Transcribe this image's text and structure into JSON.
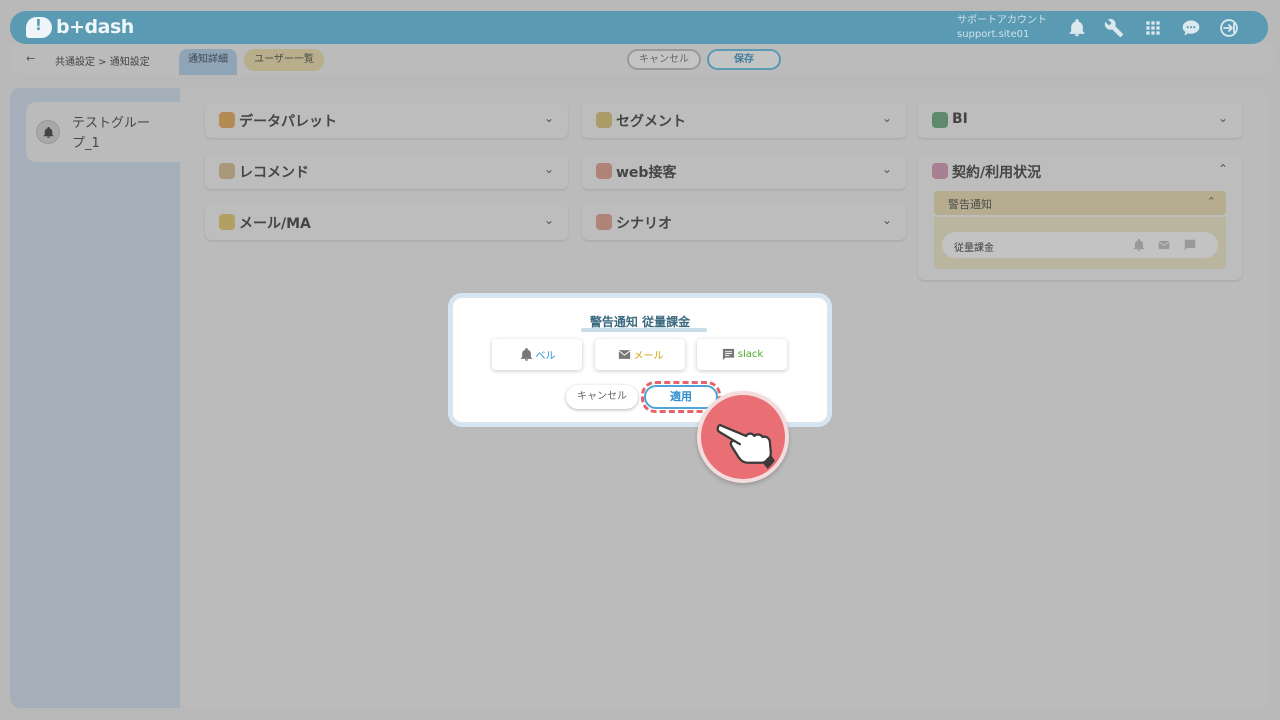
{
  "header": {
    "logo_text": "b+dash",
    "account_label": "サポートアカウント",
    "account_id": "support.site01"
  },
  "subbar": {
    "back_arrow": "←",
    "breadcrumb": "共通設定 > 通知設定",
    "tabs": [
      "通知詳細",
      "ユーザー一覧"
    ],
    "cancel_label": "キャンセル",
    "save_label": "保存"
  },
  "sidebar": {
    "group_label": "テストグループ_1"
  },
  "cards": [
    {
      "label": "データパレット",
      "icon": "palette-icon",
      "color": "#c88a3a"
    },
    {
      "label": "セグメント",
      "icon": "segment-icon",
      "color": "#b9a05a"
    },
    {
      "label": "BI",
      "icon": "chart-icon",
      "color": "#4c8a62"
    },
    {
      "label": "レコメンド",
      "icon": "recommend-icon",
      "color": "#b59a6a"
    },
    {
      "label": "web接客",
      "icon": "web-icon",
      "color": "#c07a6a"
    },
    {
      "label": "メール/MA",
      "icon": "mail-icon",
      "color": "#c9a84a"
    },
    {
      "label": "シナリオ",
      "icon": "scenario-icon",
      "color": "#c07a6a"
    }
  ],
  "chevron_down": "⌄",
  "chevron_up": "⌃",
  "contract": {
    "label": "契約/利用状況",
    "section": "警告通知",
    "row_label": "従量課金"
  },
  "modal": {
    "title": "警告通知 従量課金",
    "options": [
      "ベル",
      "メール",
      "slack"
    ],
    "cancel_label": "キャンセル",
    "apply_label": "適用"
  },
  "colors": {
    "accent": "#4ea4d6",
    "highlight": "#e7636b",
    "bell": "#2f8fd0",
    "mail": "#d4a200",
    "slack": "#4aab2a"
  }
}
